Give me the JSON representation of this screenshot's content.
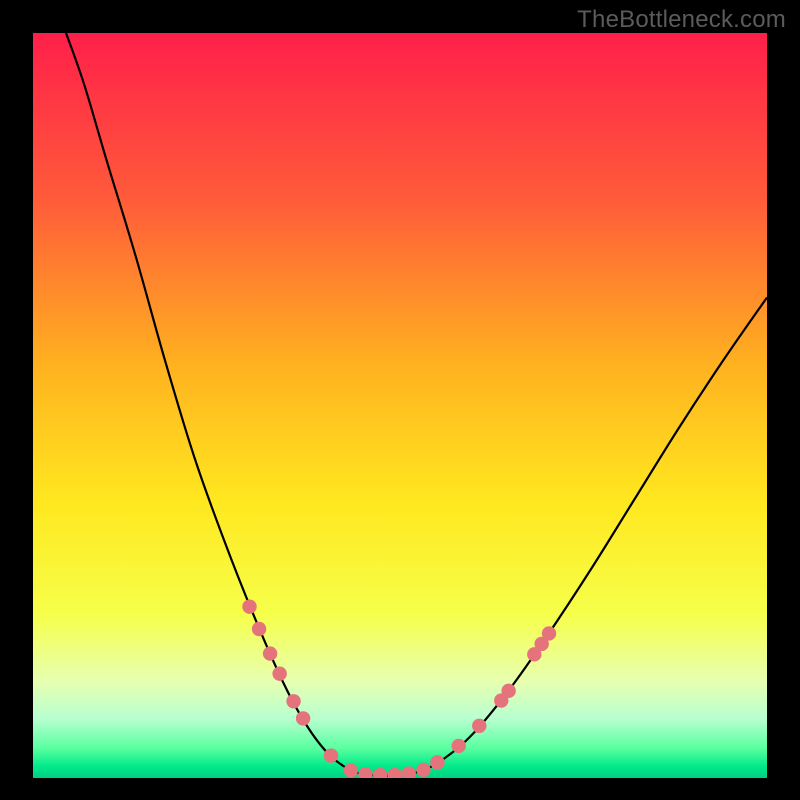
{
  "watermark": "TheBottleneck.com",
  "chart_data": {
    "type": "line",
    "title": "",
    "xlabel": "",
    "ylabel": "",
    "xlim": [
      0,
      100
    ],
    "ylim": [
      0,
      100
    ],
    "grid": false,
    "legend": false,
    "gradient_stops": [
      {
        "offset": 0.0,
        "color": "#ff1f4a"
      },
      {
        "offset": 0.22,
        "color": "#ff5a3a"
      },
      {
        "offset": 0.45,
        "color": "#ffb31f"
      },
      {
        "offset": 0.63,
        "color": "#ffe81f"
      },
      {
        "offset": 0.78,
        "color": "#f6ff4a"
      },
      {
        "offset": 0.87,
        "color": "#e7ffb0"
      },
      {
        "offset": 0.92,
        "color": "#b8ffd0"
      },
      {
        "offset": 0.96,
        "color": "#5affa0"
      },
      {
        "offset": 0.985,
        "color": "#00e98a"
      },
      {
        "offset": 1.0,
        "color": "#00d084"
      }
    ],
    "series": [
      {
        "name": "bottleneck-curve",
        "type": "line",
        "points": [
          {
            "x": 4.5,
            "y": 100.0
          },
          {
            "x": 7.0,
            "y": 93.0
          },
          {
            "x": 10.0,
            "y": 83.0
          },
          {
            "x": 14.0,
            "y": 70.0
          },
          {
            "x": 18.0,
            "y": 56.0
          },
          {
            "x": 22.0,
            "y": 43.0
          },
          {
            "x": 26.0,
            "y": 32.0
          },
          {
            "x": 30.0,
            "y": 22.0
          },
          {
            "x": 34.0,
            "y": 13.0
          },
          {
            "x": 37.0,
            "y": 7.5
          },
          {
            "x": 40.0,
            "y": 3.5
          },
          {
            "x": 43.0,
            "y": 1.2
          },
          {
            "x": 46.0,
            "y": 0.4
          },
          {
            "x": 50.0,
            "y": 0.4
          },
          {
            "x": 53.0,
            "y": 1.0
          },
          {
            "x": 56.0,
            "y": 2.6
          },
          {
            "x": 60.0,
            "y": 6.0
          },
          {
            "x": 65.0,
            "y": 12.0
          },
          {
            "x": 70.0,
            "y": 19.0
          },
          {
            "x": 76.0,
            "y": 28.0
          },
          {
            "x": 82.0,
            "y": 37.5
          },
          {
            "x": 88.0,
            "y": 47.0
          },
          {
            "x": 94.0,
            "y": 56.0
          },
          {
            "x": 100.0,
            "y": 64.5
          }
        ]
      },
      {
        "name": "markers",
        "type": "scatter",
        "color": "#e5737b",
        "points": [
          {
            "x": 29.5,
            "y": 23.0
          },
          {
            "x": 30.8,
            "y": 20.0
          },
          {
            "x": 32.3,
            "y": 16.7
          },
          {
            "x": 33.6,
            "y": 14.0
          },
          {
            "x": 35.5,
            "y": 10.3
          },
          {
            "x": 36.8,
            "y": 8.0
          },
          {
            "x": 40.6,
            "y": 3.0
          },
          {
            "x": 43.3,
            "y": 1.0
          },
          {
            "x": 45.3,
            "y": 0.5
          },
          {
            "x": 47.3,
            "y": 0.4
          },
          {
            "x": 49.3,
            "y": 0.4
          },
          {
            "x": 51.2,
            "y": 0.6
          },
          {
            "x": 53.2,
            "y": 1.1
          },
          {
            "x": 55.1,
            "y": 2.1
          },
          {
            "x": 58.0,
            "y": 4.3
          },
          {
            "x": 60.8,
            "y": 7.0
          },
          {
            "x": 63.8,
            "y": 10.4
          },
          {
            "x": 64.8,
            "y": 11.7
          },
          {
            "x": 68.3,
            "y": 16.6
          },
          {
            "x": 69.3,
            "y": 18.0
          },
          {
            "x": 70.3,
            "y": 19.4
          }
        ]
      }
    ]
  }
}
